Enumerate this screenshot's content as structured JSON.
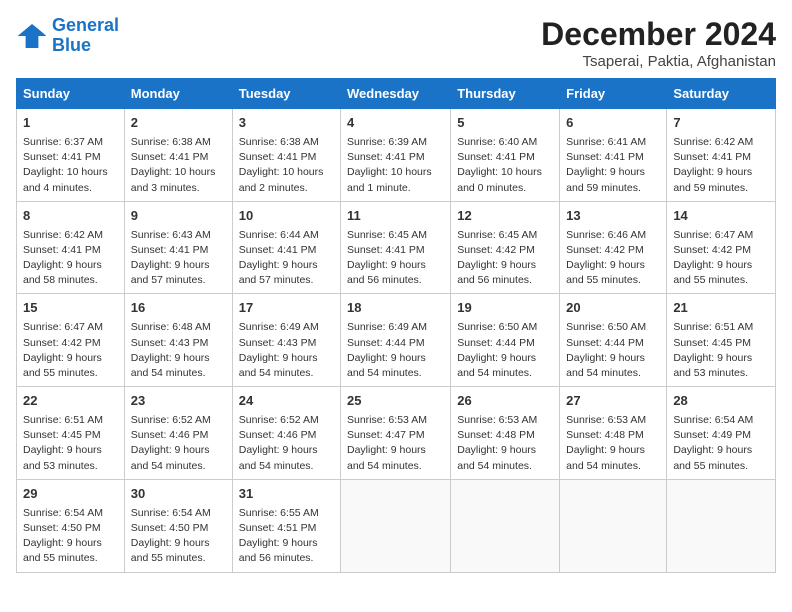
{
  "logo": {
    "general": "General",
    "blue": "Blue"
  },
  "title": "December 2024",
  "subtitle": "Tsaperai, Paktia, Afghanistan",
  "days_of_week": [
    "Sunday",
    "Monday",
    "Tuesday",
    "Wednesday",
    "Thursday",
    "Friday",
    "Saturday"
  ],
  "weeks": [
    [
      {
        "day": "1",
        "sunrise": "6:37 AM",
        "sunset": "4:41 PM",
        "daylight": "10 hours and 4 minutes."
      },
      {
        "day": "2",
        "sunrise": "6:38 AM",
        "sunset": "4:41 PM",
        "daylight": "10 hours and 3 minutes."
      },
      {
        "day": "3",
        "sunrise": "6:38 AM",
        "sunset": "4:41 PM",
        "daylight": "10 hours and 2 minutes."
      },
      {
        "day": "4",
        "sunrise": "6:39 AM",
        "sunset": "4:41 PM",
        "daylight": "10 hours and 1 minute."
      },
      {
        "day": "5",
        "sunrise": "6:40 AM",
        "sunset": "4:41 PM",
        "daylight": "10 hours and 0 minutes."
      },
      {
        "day": "6",
        "sunrise": "6:41 AM",
        "sunset": "4:41 PM",
        "daylight": "9 hours and 59 minutes."
      },
      {
        "day": "7",
        "sunrise": "6:42 AM",
        "sunset": "4:41 PM",
        "daylight": "9 hours and 59 minutes."
      }
    ],
    [
      {
        "day": "8",
        "sunrise": "6:42 AM",
        "sunset": "4:41 PM",
        "daylight": "9 hours and 58 minutes."
      },
      {
        "day": "9",
        "sunrise": "6:43 AM",
        "sunset": "4:41 PM",
        "daylight": "9 hours and 57 minutes."
      },
      {
        "day": "10",
        "sunrise": "6:44 AM",
        "sunset": "4:41 PM",
        "daylight": "9 hours and 57 minutes."
      },
      {
        "day": "11",
        "sunrise": "6:45 AM",
        "sunset": "4:41 PM",
        "daylight": "9 hours and 56 minutes."
      },
      {
        "day": "12",
        "sunrise": "6:45 AM",
        "sunset": "4:42 PM",
        "daylight": "9 hours and 56 minutes."
      },
      {
        "day": "13",
        "sunrise": "6:46 AM",
        "sunset": "4:42 PM",
        "daylight": "9 hours and 55 minutes."
      },
      {
        "day": "14",
        "sunrise": "6:47 AM",
        "sunset": "4:42 PM",
        "daylight": "9 hours and 55 minutes."
      }
    ],
    [
      {
        "day": "15",
        "sunrise": "6:47 AM",
        "sunset": "4:42 PM",
        "daylight": "9 hours and 55 minutes."
      },
      {
        "day": "16",
        "sunrise": "6:48 AM",
        "sunset": "4:43 PM",
        "daylight": "9 hours and 54 minutes."
      },
      {
        "day": "17",
        "sunrise": "6:49 AM",
        "sunset": "4:43 PM",
        "daylight": "9 hours and 54 minutes."
      },
      {
        "day": "18",
        "sunrise": "6:49 AM",
        "sunset": "4:44 PM",
        "daylight": "9 hours and 54 minutes."
      },
      {
        "day": "19",
        "sunrise": "6:50 AM",
        "sunset": "4:44 PM",
        "daylight": "9 hours and 54 minutes."
      },
      {
        "day": "20",
        "sunrise": "6:50 AM",
        "sunset": "4:44 PM",
        "daylight": "9 hours and 54 minutes."
      },
      {
        "day": "21",
        "sunrise": "6:51 AM",
        "sunset": "4:45 PM",
        "daylight": "9 hours and 53 minutes."
      }
    ],
    [
      {
        "day": "22",
        "sunrise": "6:51 AM",
        "sunset": "4:45 PM",
        "daylight": "9 hours and 53 minutes."
      },
      {
        "day": "23",
        "sunrise": "6:52 AM",
        "sunset": "4:46 PM",
        "daylight": "9 hours and 54 minutes."
      },
      {
        "day": "24",
        "sunrise": "6:52 AM",
        "sunset": "4:46 PM",
        "daylight": "9 hours and 54 minutes."
      },
      {
        "day": "25",
        "sunrise": "6:53 AM",
        "sunset": "4:47 PM",
        "daylight": "9 hours and 54 minutes."
      },
      {
        "day": "26",
        "sunrise": "6:53 AM",
        "sunset": "4:48 PM",
        "daylight": "9 hours and 54 minutes."
      },
      {
        "day": "27",
        "sunrise": "6:53 AM",
        "sunset": "4:48 PM",
        "daylight": "9 hours and 54 minutes."
      },
      {
        "day": "28",
        "sunrise": "6:54 AM",
        "sunset": "4:49 PM",
        "daylight": "9 hours and 55 minutes."
      }
    ],
    [
      {
        "day": "29",
        "sunrise": "6:54 AM",
        "sunset": "4:50 PM",
        "daylight": "9 hours and 55 minutes."
      },
      {
        "day": "30",
        "sunrise": "6:54 AM",
        "sunset": "4:50 PM",
        "daylight": "9 hours and 55 minutes."
      },
      {
        "day": "31",
        "sunrise": "6:55 AM",
        "sunset": "4:51 PM",
        "daylight": "9 hours and 56 minutes."
      },
      null,
      null,
      null,
      null
    ]
  ]
}
